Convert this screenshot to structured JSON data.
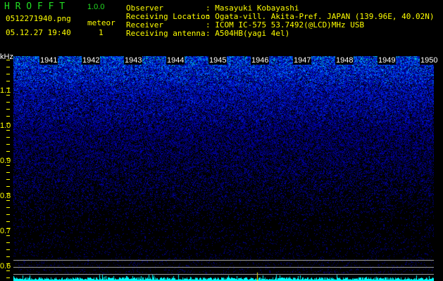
{
  "app": {
    "name": "H R O F F T",
    "version": "1.0.0"
  },
  "file": {
    "name": "0512271940.png",
    "datetime": "05.12.27 19:40"
  },
  "meteor": {
    "label": "meteor",
    "count": "1"
  },
  "info": [
    {
      "label": "Observer",
      "value": ": Masayuki Kobayashi"
    },
    {
      "label": "Receiving Location",
      "value": ": Ogata-vill. Akita-Pref. JAPAN (139.96E, 40.02N)"
    },
    {
      "label": "Receiver",
      "value": ": ICOM IC-575 53.7492(@LCD)MHz USB"
    },
    {
      "label": "Receiving antenna",
      "value": ": A504HB(yagi 4el)"
    }
  ],
  "spectrogram": {
    "unit": "kHz",
    "y_ticks": [
      "1.1",
      "1.0",
      "0.9",
      "0.8",
      "0.7",
      "0.6"
    ],
    "time_labels": [
      "1941",
      "1942",
      "1943",
      "1944",
      "1945",
      "1946",
      "1947",
      "1948",
      "1949",
      "1950"
    ],
    "colors": {
      "low": "#0000aa",
      "mid": "#0066ff",
      "high": "#00ffcc",
      "peak": "#ffff00",
      "bars": "#00ffff"
    }
  }
}
